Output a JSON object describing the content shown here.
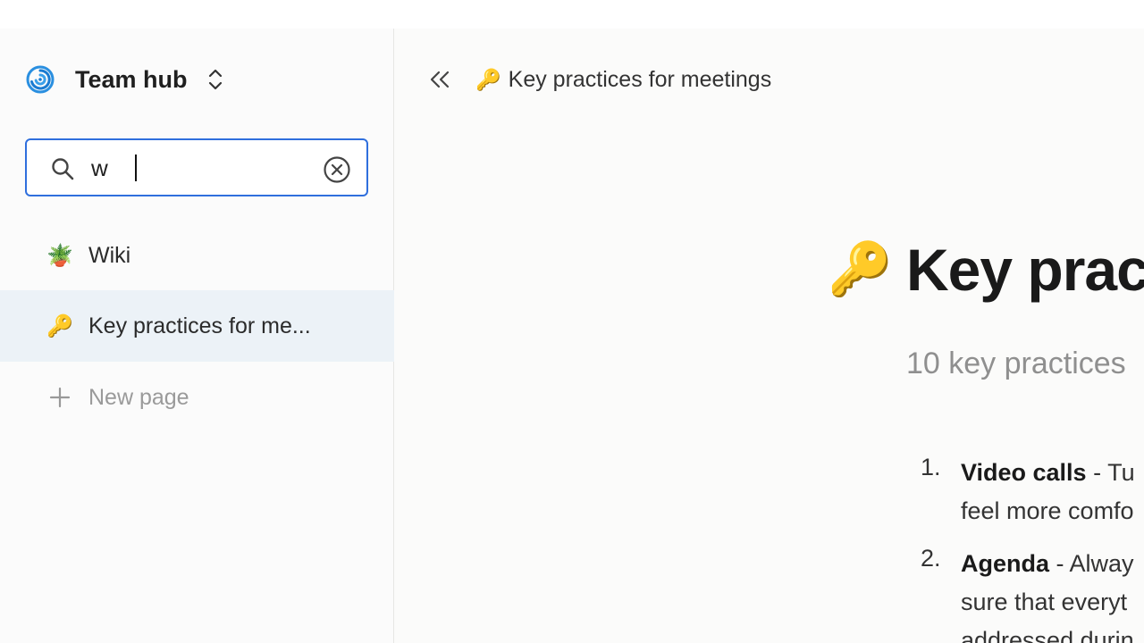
{
  "workspace": {
    "name": "Team hub",
    "logo_icon": "spiral-icon",
    "switch_icon": "chevron-up-down-icon"
  },
  "search": {
    "value": "w",
    "placeholder": "",
    "search_icon": "search-icon",
    "clear_icon": "clear-circle-icon",
    "accent_color": "#2f6fdd"
  },
  "sidebar": {
    "items": [
      {
        "emoji": "🪴",
        "label": "Wiki",
        "selected": false
      },
      {
        "emoji": "🔑",
        "label": "Key practices for me...",
        "selected": true
      }
    ],
    "new_page": {
      "label": "New page",
      "icon": "plus-icon"
    },
    "selected_bg": "#ecf2f7"
  },
  "topbar": {
    "collapse_icon": "double-chevron-left-icon",
    "breadcrumb": {
      "emoji": "🔑",
      "label": "Key practices for meetings"
    }
  },
  "document": {
    "emoji": "🔑",
    "title": "Key prac",
    "subtitle": "10 key practices",
    "list": [
      {
        "number": "1.",
        "term": "Video calls",
        "line1_rest": " - Tu",
        "line2": "feel more comfo"
      },
      {
        "number": "2.",
        "term": "Agenda",
        "line1_rest": " - Alway",
        "line2": "sure that everyt",
        "line3": "addressed durin"
      }
    ]
  }
}
